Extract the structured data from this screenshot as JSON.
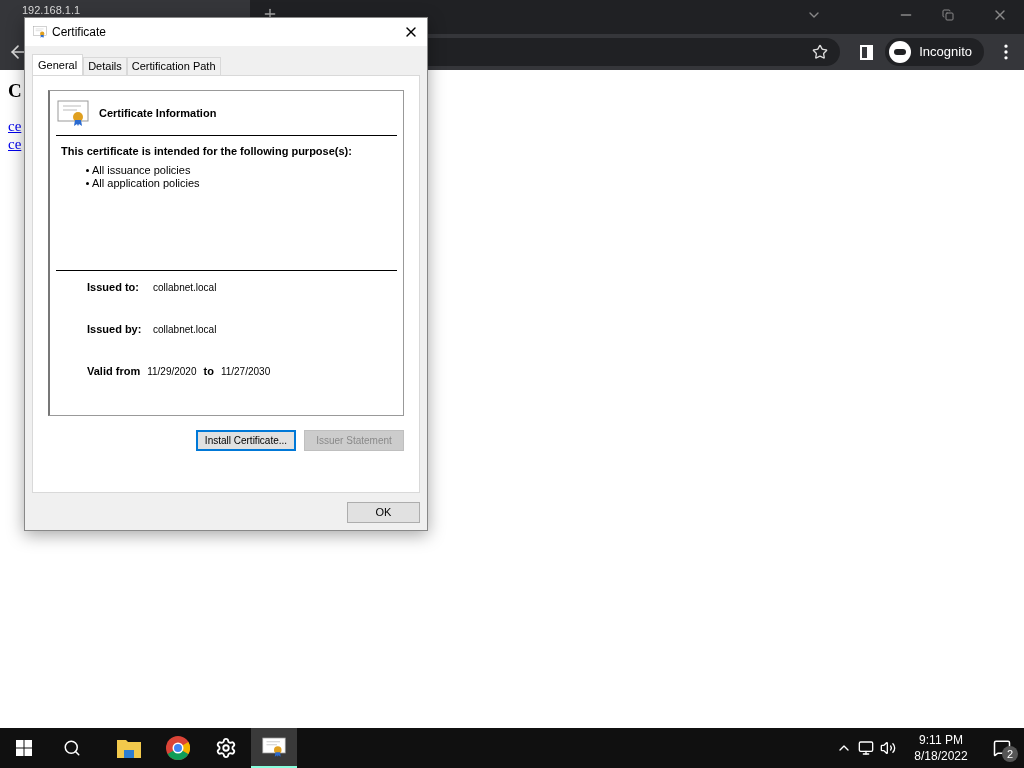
{
  "browser": {
    "tab_title": "192.168.1.1",
    "profile": "Incognito"
  },
  "page": {
    "heading": "C",
    "links": [
      "ce",
      "ce"
    ]
  },
  "dialog": {
    "title": "Certificate",
    "tabs": [
      {
        "label": "General",
        "selected": true
      },
      {
        "label": "Details",
        "selected": false
      },
      {
        "label": "Certification Path",
        "selected": false
      }
    ],
    "info_title": "Certificate Information",
    "purpose_heading": "This certificate is intended for the following purpose(s):",
    "purposes": [
      "All issuance policies",
      "All application policies"
    ],
    "issued_to_label": "Issued to:",
    "issued_to": "collabnet.local",
    "issued_by_label": "Issued by:",
    "issued_by": "collabnet.local",
    "valid_from_label": "Valid from",
    "valid_from": "11/29/2020",
    "to_label": "to",
    "valid_to": "11/27/2030",
    "buttons": [
      {
        "label": "Install Certificate...",
        "disabled": false,
        "focused": true
      },
      {
        "label": "Issuer Statement",
        "disabled": true,
        "focused": false
      }
    ],
    "ok": "OK"
  },
  "taskbar": {
    "time": "9:11 PM",
    "date": "8/18/2022",
    "notifications": "2"
  }
}
